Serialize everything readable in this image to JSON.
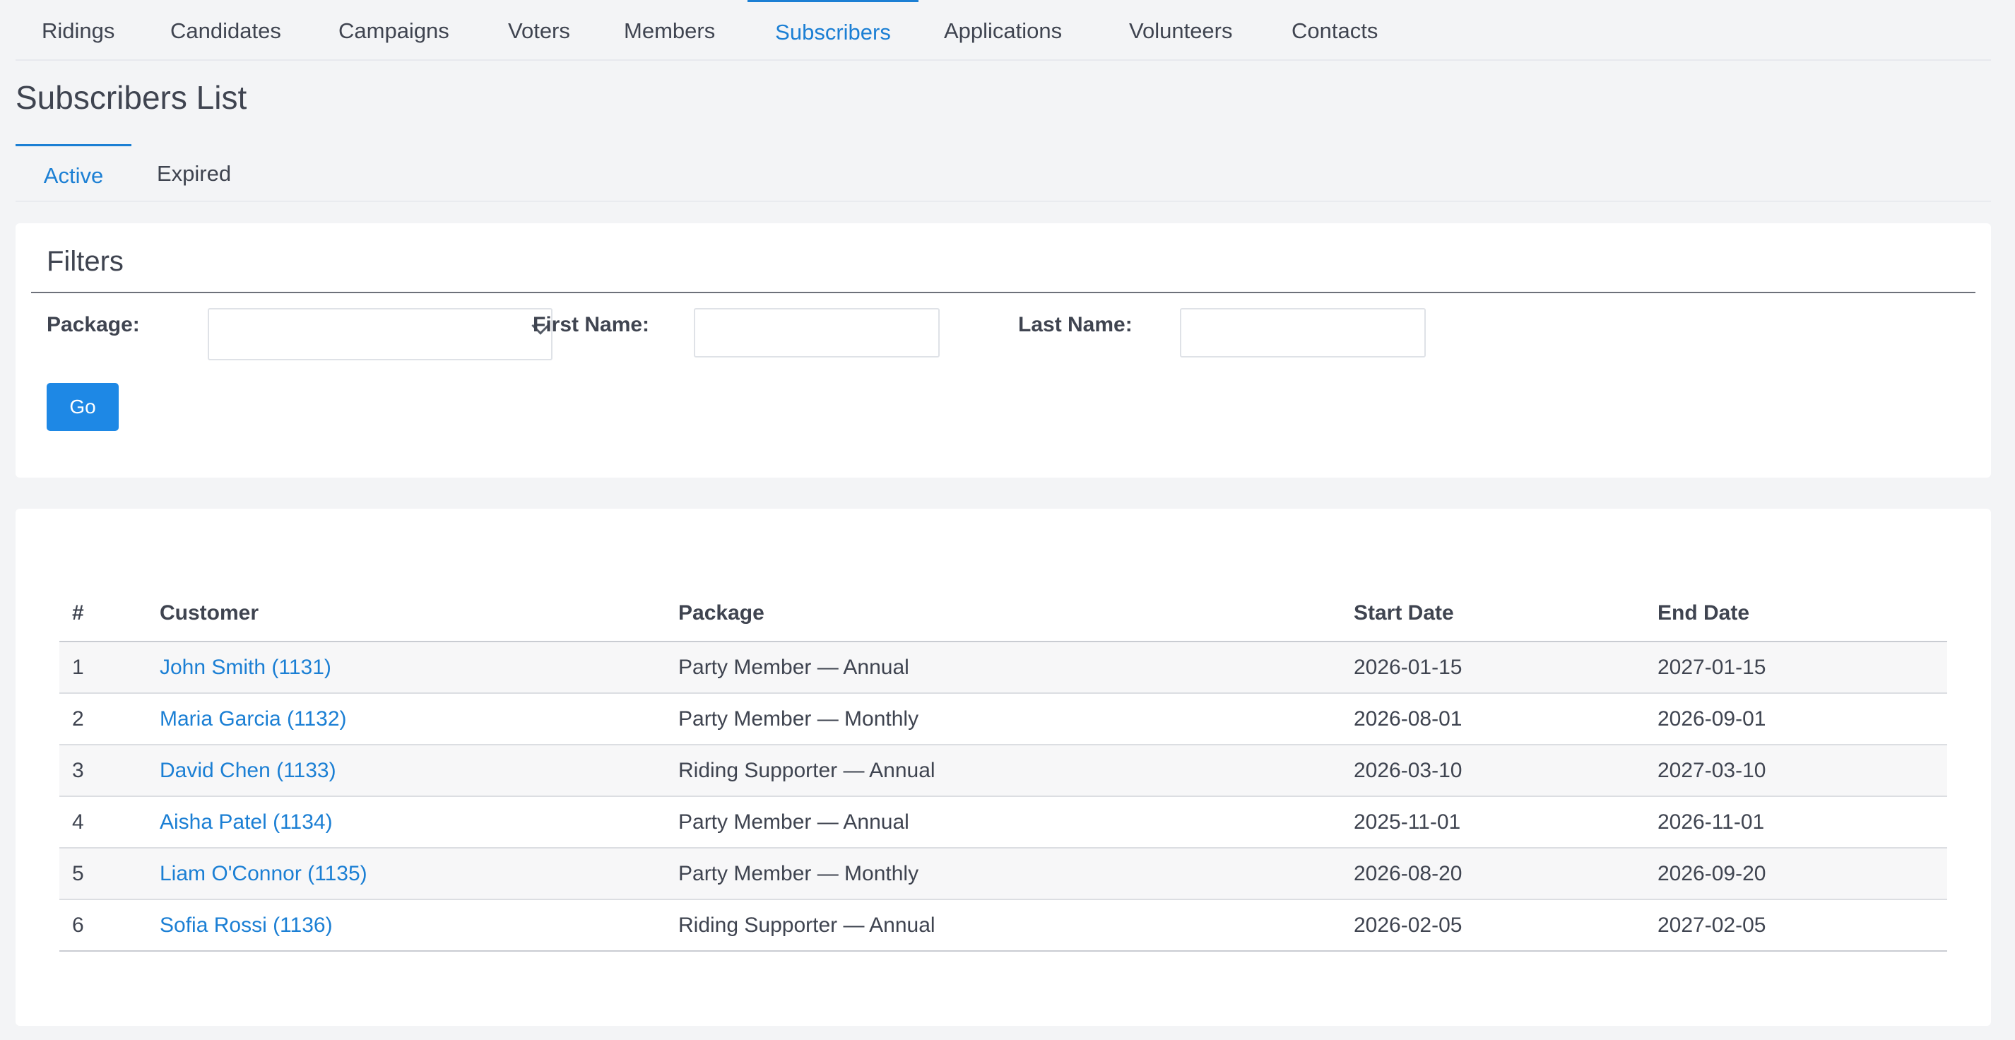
{
  "nav": {
    "items": [
      {
        "label": "Ridings"
      },
      {
        "label": "Candidates"
      },
      {
        "label": "Campaigns"
      },
      {
        "label": "Voters"
      },
      {
        "label": "Members"
      },
      {
        "label": "Subscribers"
      },
      {
        "label": "Applications"
      },
      {
        "label": "Volunteers"
      },
      {
        "label": "Contacts"
      }
    ],
    "active": "Subscribers"
  },
  "page": {
    "title": "Subscribers List"
  },
  "subtabs": {
    "items": [
      {
        "label": "Active"
      },
      {
        "label": "Expired"
      }
    ],
    "active": "Active"
  },
  "filters": {
    "title": "Filters",
    "package_label": "Package:",
    "package_value": "",
    "first_name_label": "First Name:",
    "first_name_value": "",
    "last_name_label": "Last Name:",
    "last_name_value": "",
    "go_label": "Go"
  },
  "table": {
    "headers": [
      "#",
      "Customer",
      "Package",
      "Start Date",
      "End Date"
    ],
    "rows": [
      {
        "num": "1",
        "customer": "John Smith (1131)",
        "package": "Party Member — Annual",
        "start": "2026-01-15",
        "end": "2027-01-15"
      },
      {
        "num": "2",
        "customer": "Maria Garcia (1132)",
        "package": "Party Member — Monthly",
        "start": "2026-08-01",
        "end": "2026-09-01"
      },
      {
        "num": "3",
        "customer": "David Chen (1133)",
        "package": "Riding Supporter — Annual",
        "start": "2026-03-10",
        "end": "2027-03-10"
      },
      {
        "num": "4",
        "customer": "Aisha Patel (1134)",
        "package": "Party Member — Annual",
        "start": "2025-11-01",
        "end": "2026-11-01"
      },
      {
        "num": "5",
        "customer": "Liam O'Connor (1135)",
        "package": "Party Member — Monthly",
        "start": "2026-08-20",
        "end": "2026-09-20"
      },
      {
        "num": "6",
        "customer": "Sofia Rossi (1136)",
        "package": "Riding Supporter — Annual",
        "start": "2026-02-05",
        "end": "2027-02-05"
      }
    ]
  },
  "colors": {
    "accent": "#1b7fd4",
    "button": "#1e88e5",
    "background": "#f3f4f6",
    "card": "#ffffff",
    "text": "#3f4450"
  }
}
